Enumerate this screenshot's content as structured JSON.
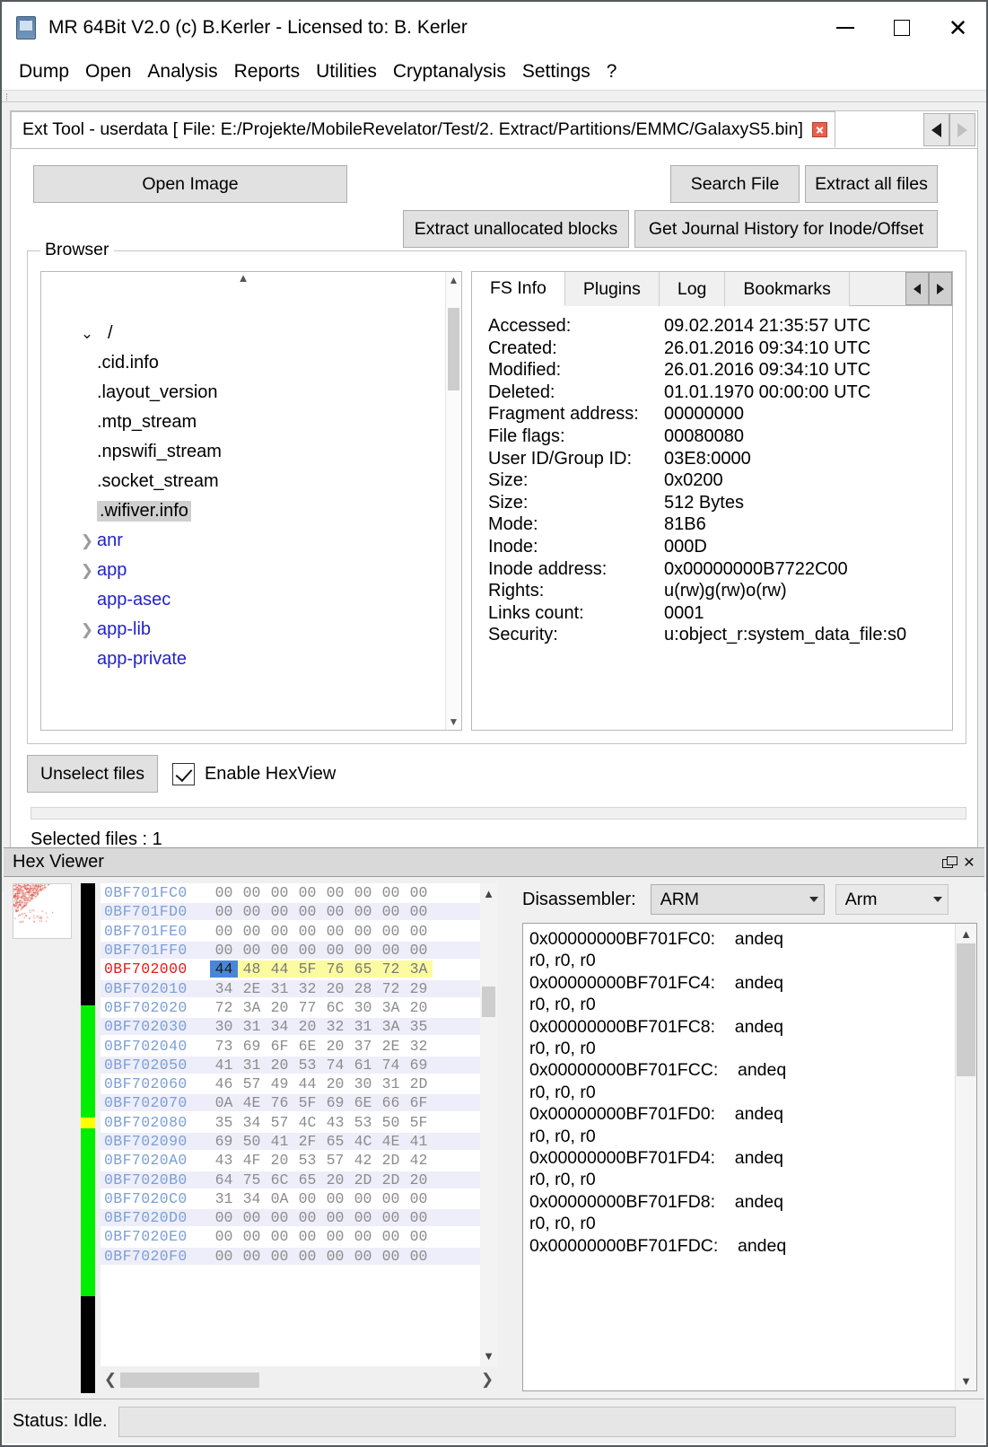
{
  "window": {
    "title": "MR 64Bit V2.0 (c) B.Kerler - Licensed to: B. Kerler",
    "icon": "phone-chip-icon",
    "minimize": "minimize-icon",
    "maximize": "maximize-icon",
    "close": "close-icon"
  },
  "menu": {
    "items": [
      "Dump",
      "Open",
      "Analysis",
      "Reports",
      "Utilities",
      "Cryptanalysis",
      "Settings",
      "?"
    ]
  },
  "tabs": {
    "active_label": "Ext Tool - userdata [ File: E:/Projekte/MobileRevelator/Test/2. Extract/Partitions/EMMC/GalaxyS5.bin]",
    "nav_prev": "prev-tab-icon",
    "nav_next": "next-tab-icon"
  },
  "toolbar": {
    "open_image": "Open Image",
    "search_file": "Search File",
    "extract_all": "Extract all files",
    "extract_unallocated": "Extract unallocated blocks",
    "journal_history": "Get Journal History for Inode/Offset"
  },
  "browser": {
    "group_label": "Browser",
    "tree": [
      {
        "name": "/",
        "type": "root",
        "chevron": "down",
        "selected": false
      },
      {
        "name": ".cid.info",
        "type": "file",
        "chevron": "none",
        "selected": false
      },
      {
        "name": ".layout_version",
        "type": "file",
        "chevron": "none",
        "selected": false
      },
      {
        "name": ".mtp_stream",
        "type": "file",
        "chevron": "none",
        "selected": false
      },
      {
        "name": ".npswifi_stream",
        "type": "file",
        "chevron": "none",
        "selected": false
      },
      {
        "name": ".socket_stream",
        "type": "file",
        "chevron": "none",
        "selected": false
      },
      {
        "name": ".wifiver.info",
        "type": "file",
        "chevron": "none",
        "selected": true
      },
      {
        "name": "anr",
        "type": "dir",
        "chevron": "right",
        "selected": false
      },
      {
        "name": "app",
        "type": "dir",
        "chevron": "right",
        "selected": false
      },
      {
        "name": "app-asec",
        "type": "dir",
        "chevron": "none",
        "selected": false
      },
      {
        "name": "app-lib",
        "type": "dir",
        "chevron": "right",
        "selected": false
      },
      {
        "name": "app-private",
        "type": "dir",
        "chevron": "none",
        "selected": false
      }
    ]
  },
  "info": {
    "tabs": [
      "FS Info",
      "Plugins",
      "Log",
      "Bookmarks"
    ],
    "active_tab": "FS Info",
    "nav_prev": "prev-pane-icon",
    "nav_next": "next-pane-icon",
    "rows": [
      {
        "key": "Accessed:",
        "value": "09.02.2014 21:35:57 UTC"
      },
      {
        "key": "Created:",
        "value": "26.01.2016 09:34:10 UTC"
      },
      {
        "key": "Modified:",
        "value": "26.01.2016 09:34:10 UTC"
      },
      {
        "key": "Deleted:",
        "value": "01.01.1970 00:00:00 UTC"
      },
      {
        "key": "Fragment address:",
        "value": "00000000"
      },
      {
        "key": "File flags:",
        "value": "00080080"
      },
      {
        "key": "User ID/Group ID:",
        "value": "03E8:0000"
      },
      {
        "key": "Size:",
        "value": "0x0200"
      },
      {
        "key": "Size:",
        "value": "512 Bytes"
      },
      {
        "key": "Mode:",
        "value": "81B6"
      },
      {
        "key": "Inode:",
        "value": "000D"
      },
      {
        "key": "Inode address:",
        "value": "0x00000000B7722C00"
      },
      {
        "key": "Rights:",
        "value": "u(rw)g(rw)o(rw)"
      },
      {
        "key": "Links count:",
        "value": "0001"
      },
      {
        "key": "Security:",
        "value": "u:object_r:system_data_file:s0"
      }
    ]
  },
  "actions": {
    "unselect_files": "Unselect files",
    "enable_hexview": "Enable HexView",
    "hexview_checked": true,
    "selected_files": "Selected files : 1",
    "progress1_pct": "0%",
    "progress2_pct": "0%",
    "progress1_value": 0,
    "progress2_value": 0
  },
  "hexviewer": {
    "panel_title": "Hex Viewer",
    "float_icon": "float-window-icon",
    "close_icon": "close-icon",
    "thumbnail": "entropy-thumbnail",
    "cursor_address": "0BF702000",
    "rows": [
      {
        "addr": "0BF701FC0",
        "bytes": [
          "00",
          "00",
          "00",
          "00",
          "00",
          "00",
          "00",
          "00"
        ],
        "highlight": "none"
      },
      {
        "addr": "0BF701FD0",
        "bytes": [
          "00",
          "00",
          "00",
          "00",
          "00",
          "00",
          "00",
          "00"
        ],
        "highlight": "none"
      },
      {
        "addr": "0BF701FE0",
        "bytes": [
          "00",
          "00",
          "00",
          "00",
          "00",
          "00",
          "00",
          "00"
        ],
        "highlight": "none"
      },
      {
        "addr": "0BF701FF0",
        "bytes": [
          "00",
          "00",
          "00",
          "00",
          "00",
          "00",
          "00",
          "00"
        ],
        "highlight": "none"
      },
      {
        "addr": "0BF702000",
        "bytes": [
          "44",
          "48",
          "44",
          "5F",
          "76",
          "65",
          "72",
          "3A"
        ],
        "highlight": "selected",
        "cursor": true
      },
      {
        "addr": "0BF702010",
        "bytes": [
          "34",
          "2E",
          "31",
          "32",
          "20",
          "28",
          "72",
          "29"
        ],
        "highlight": "none"
      },
      {
        "addr": "0BF702020",
        "bytes": [
          "72",
          "3A",
          "20",
          "77",
          "6C",
          "30",
          "3A",
          "20"
        ],
        "highlight": "none"
      },
      {
        "addr": "0BF702030",
        "bytes": [
          "30",
          "31",
          "34",
          "20",
          "32",
          "31",
          "3A",
          "35"
        ],
        "highlight": "none"
      },
      {
        "addr": "0BF702040",
        "bytes": [
          "73",
          "69",
          "6F",
          "6E",
          "20",
          "37",
          "2E",
          "32"
        ],
        "highlight": "none"
      },
      {
        "addr": "0BF702050",
        "bytes": [
          "41",
          "31",
          "20",
          "53",
          "74",
          "61",
          "74",
          "69"
        ],
        "highlight": "none"
      },
      {
        "addr": "0BF702060",
        "bytes": [
          "46",
          "57",
          "49",
          "44",
          "20",
          "30",
          "31",
          "2D"
        ],
        "highlight": "none"
      },
      {
        "addr": "0BF702070",
        "bytes": [
          "0A",
          "4E",
          "76",
          "5F",
          "69",
          "6E",
          "66",
          "6F"
        ],
        "highlight": "none"
      },
      {
        "addr": "0BF702080",
        "bytes": [
          "35",
          "34",
          "57",
          "4C",
          "43",
          "53",
          "50",
          "5F"
        ],
        "highlight": "none"
      },
      {
        "addr": "0BF702090",
        "bytes": [
          "69",
          "50",
          "41",
          "2F",
          "65",
          "4C",
          "4E",
          "41"
        ],
        "highlight": "none"
      },
      {
        "addr": "0BF7020A0",
        "bytes": [
          "43",
          "4F",
          "20",
          "53",
          "57",
          "42",
          "2D",
          "42"
        ],
        "highlight": "none"
      },
      {
        "addr": "0BF7020B0",
        "bytes": [
          "64",
          "75",
          "6C",
          "65",
          "20",
          "2D",
          "2D",
          "20"
        ],
        "highlight": "none"
      },
      {
        "addr": "0BF7020C0",
        "bytes": [
          "31",
          "34",
          "0A",
          "00",
          "00",
          "00",
          "00",
          "00"
        ],
        "highlight": "none"
      },
      {
        "addr": "0BF7020D0",
        "bytes": [
          "00",
          "00",
          "00",
          "00",
          "00",
          "00",
          "00",
          "00"
        ],
        "highlight": "none"
      },
      {
        "addr": "0BF7020E0",
        "bytes": [
          "00",
          "00",
          "00",
          "00",
          "00",
          "00",
          "00",
          "00"
        ],
        "highlight": "none"
      },
      {
        "addr": "0BF7020F0",
        "bytes": [
          "00",
          "00",
          "00",
          "00",
          "00",
          "00",
          "00",
          "00"
        ],
        "highlight": "none"
      }
    ],
    "colorstrip": [
      {
        "color": "#000000",
        "weight": 24
      },
      {
        "color": "#00ef00",
        "weight": 22
      },
      {
        "color": "#ffff00",
        "weight": 2
      },
      {
        "color": "#00ef00",
        "weight": 33
      },
      {
        "color": "#000000",
        "weight": 19
      }
    ],
    "scroll_left_icon": "scroll-left-icon",
    "scroll_right_icon": "scroll-right-icon"
  },
  "disassembler": {
    "label": "Disassembler:",
    "arch_value": "ARM",
    "mode_value": "Arm",
    "lines": [
      "0x00000000BF701FC0:    andeq",
      "r0, r0, r0",
      "0x00000000BF701FC4:    andeq",
      "r0, r0, r0",
      "0x00000000BF701FC8:    andeq",
      "r0, r0, r0",
      "0x00000000BF701FCC:    andeq",
      "r0, r0, r0",
      "0x00000000BF701FD0:    andeq",
      "r0, r0, r0",
      "0x00000000BF701FD4:    andeq",
      "r0, r0, r0",
      "0x00000000BF701FD8:    andeq",
      "r0, r0, r0",
      "0x00000000BF701FDC:    andeq"
    ]
  },
  "statusbar": {
    "text": "Status: Idle.",
    "field_value": ""
  },
  "colors": {
    "link": "#2222cc",
    "hex_addr": "#7b9fd6",
    "hex_cursor": "#e01b1b",
    "hex_selection": "#4a86d8",
    "hex_highlight": "#fdfba0",
    "tab_close": "#e8604c",
    "button_face": "#e1e1e1"
  }
}
